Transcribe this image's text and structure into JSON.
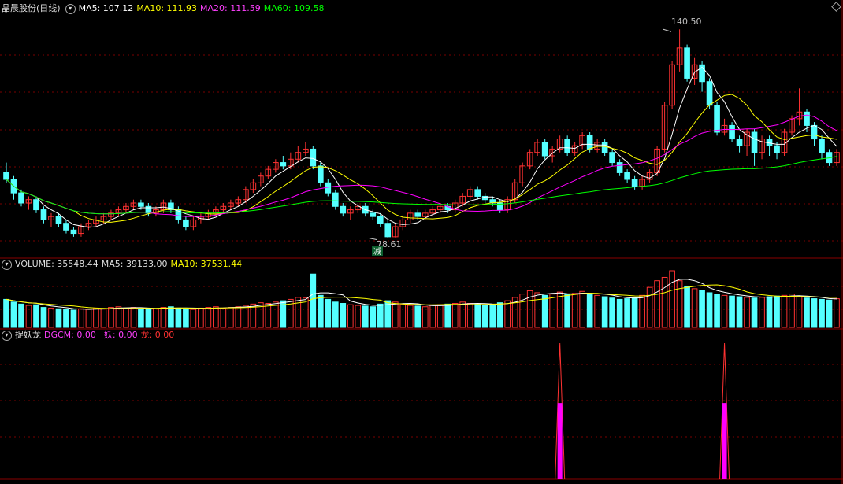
{
  "header": {
    "stock_name": "晶晨股份(日线)",
    "ma5": "MA5: 107.12",
    "ma10": "MA10: 111.93",
    "ma20": "MA20: 111.59",
    "ma60": "MA60: 109.58"
  },
  "volume_header": {
    "volume": "VOLUME: 35548.44",
    "ma5": "MA5: 39133.00",
    "ma10": "MA10: 37531.44"
  },
  "indicator_header": {
    "name": "捉妖龙",
    "dgcm": "DGCM: 0.00",
    "yao": "妖: 0.00",
    "long": "龙: 0.00"
  },
  "annotations": {
    "high_label": "140.50",
    "low_label": "78.61",
    "jian_marker": "减"
  },
  "colors": {
    "background": "#000000",
    "up": "#ff3232",
    "down": "#54ffff",
    "ma5": "#ffffff",
    "ma10": "#ffff00",
    "ma20": "#ff00ff",
    "ma60": "#00ff00",
    "grid": "#7a0000"
  },
  "chart_data": {
    "type": "candlestick",
    "price_high_marker": 140.5,
    "price_low_marker": 78.61,
    "candles": [
      {
        "o": 98,
        "c": 96,
        "h": 101,
        "l": 95
      },
      {
        "o": 96,
        "c": 92,
        "h": 97,
        "l": 90
      },
      {
        "o": 92,
        "c": 89,
        "h": 93,
        "l": 88
      },
      {
        "o": 89,
        "c": 90,
        "h": 91,
        "l": 87
      },
      {
        "o": 90,
        "c": 87,
        "h": 91,
        "l": 86
      },
      {
        "o": 87,
        "c": 84,
        "h": 88,
        "l": 83
      },
      {
        "o": 84,
        "c": 85,
        "h": 86,
        "l": 82
      },
      {
        "o": 85,
        "c": 83,
        "h": 86,
        "l": 82
      },
      {
        "o": 83,
        "c": 81,
        "h": 84,
        "l": 80
      },
      {
        "o": 81,
        "c": 80,
        "h": 82,
        "l": 79
      },
      {
        "o": 80,
        "c": 82,
        "h": 83,
        "l": 79
      },
      {
        "o": 82,
        "c": 83,
        "h": 84,
        "l": 81
      },
      {
        "o": 83,
        "c": 84,
        "h": 85,
        "l": 82
      },
      {
        "o": 84,
        "c": 85,
        "h": 86,
        "l": 83
      },
      {
        "o": 85,
        "c": 86,
        "h": 87,
        "l": 84
      },
      {
        "o": 86,
        "c": 87,
        "h": 88,
        "l": 85
      },
      {
        "o": 87,
        "c": 88,
        "h": 89,
        "l": 86
      },
      {
        "o": 88,
        "c": 89,
        "h": 90,
        "l": 87
      },
      {
        "o": 89,
        "c": 88,
        "h": 90,
        "l": 87
      },
      {
        "o": 88,
        "c": 86,
        "h": 89,
        "l": 85
      },
      {
        "o": 86,
        "c": 87,
        "h": 88,
        "l": 85
      },
      {
        "o": 87,
        "c": 89,
        "h": 90,
        "l": 86
      },
      {
        "o": 89,
        "c": 87,
        "h": 90,
        "l": 86
      },
      {
        "o": 87,
        "c": 84,
        "h": 88,
        "l": 83
      },
      {
        "o": 84,
        "c": 82,
        "h": 85,
        "l": 81
      },
      {
        "o": 82,
        "c": 84,
        "h": 85,
        "l": 81
      },
      {
        "o": 84,
        "c": 85,
        "h": 86,
        "l": 83
      },
      {
        "o": 85,
        "c": 86,
        "h": 87,
        "l": 84
      },
      {
        "o": 86,
        "c": 87,
        "h": 88,
        "l": 85
      },
      {
        "o": 87,
        "c": 88,
        "h": 89,
        "l": 86
      },
      {
        "o": 88,
        "c": 89,
        "h": 90,
        "l": 87
      },
      {
        "o": 89,
        "c": 90,
        "h": 91,
        "l": 88
      },
      {
        "o": 90,
        "c": 93,
        "h": 94,
        "l": 89
      },
      {
        "o": 93,
        "c": 95,
        "h": 96,
        "l": 92
      },
      {
        "o": 95,
        "c": 97,
        "h": 98,
        "l": 94
      },
      {
        "o": 97,
        "c": 99,
        "h": 100,
        "l": 96
      },
      {
        "o": 99,
        "c": 101,
        "h": 102,
        "l": 98
      },
      {
        "o": 101,
        "c": 100,
        "h": 103,
        "l": 99
      },
      {
        "o": 100,
        "c": 102,
        "h": 104,
        "l": 99
      },
      {
        "o": 102,
        "c": 104,
        "h": 106,
        "l": 101
      },
      {
        "o": 104,
        "c": 105,
        "h": 107,
        "l": 103
      },
      {
        "o": 105,
        "c": 100,
        "h": 106,
        "l": 99
      },
      {
        "o": 100,
        "c": 95,
        "h": 101,
        "l": 94
      },
      {
        "o": 95,
        "c": 92,
        "h": 96,
        "l": 91
      },
      {
        "o": 92,
        "c": 88,
        "h": 93,
        "l": 87
      },
      {
        "o": 88,
        "c": 86,
        "h": 89,
        "l": 85
      },
      {
        "o": 86,
        "c": 87,
        "h": 88,
        "l": 84
      },
      {
        "o": 87,
        "c": 88,
        "h": 89,
        "l": 86
      },
      {
        "o": 88,
        "c": 86,
        "h": 89,
        "l": 85
      },
      {
        "o": 86,
        "c": 85,
        "h": 87,
        "l": 84
      },
      {
        "o": 85,
        "c": 83,
        "h": 86,
        "l": 82
      },
      {
        "o": 83,
        "c": 79,
        "h": 84,
        "l": 78.61
      },
      {
        "o": 79,
        "c": 82,
        "h": 83,
        "l": 78.8
      },
      {
        "o": 82,
        "c": 84,
        "h": 85,
        "l": 81
      },
      {
        "o": 84,
        "c": 86,
        "h": 87,
        "l": 83
      },
      {
        "o": 86,
        "c": 85,
        "h": 87,
        "l": 84
      },
      {
        "o": 85,
        "c": 86,
        "h": 87,
        "l": 84
      },
      {
        "o": 86,
        "c": 87,
        "h": 88,
        "l": 85
      },
      {
        "o": 87,
        "c": 88,
        "h": 89,
        "l": 86
      },
      {
        "o": 88,
        "c": 87,
        "h": 89,
        "l": 86
      },
      {
        "o": 87,
        "c": 89,
        "h": 90,
        "l": 86
      },
      {
        "o": 89,
        "c": 91,
        "h": 92,
        "l": 88
      },
      {
        "o": 91,
        "c": 93,
        "h": 94,
        "l": 90
      },
      {
        "o": 93,
        "c": 91,
        "h": 94,
        "l": 90
      },
      {
        "o": 91,
        "c": 90,
        "h": 92,
        "l": 89
      },
      {
        "o": 90,
        "c": 89,
        "h": 91,
        "l": 88
      },
      {
        "o": 89,
        "c": 87,
        "h": 90,
        "l": 86
      },
      {
        "o": 87,
        "c": 90,
        "h": 91,
        "l": 86
      },
      {
        "o": 90,
        "c": 95,
        "h": 96,
        "l": 89
      },
      {
        "o": 95,
        "c": 100,
        "h": 101,
        "l": 94
      },
      {
        "o": 100,
        "c": 104,
        "h": 105,
        "l": 99
      },
      {
        "o": 104,
        "c": 107,
        "h": 108,
        "l": 103
      },
      {
        "o": 107,
        "c": 103,
        "h": 108,
        "l": 102
      },
      {
        "o": 103,
        "c": 105,
        "h": 106,
        "l": 101
      },
      {
        "o": 105,
        "c": 108,
        "h": 109,
        "l": 104
      },
      {
        "o": 108,
        "c": 104,
        "h": 109,
        "l": 103
      },
      {
        "o": 104,
        "c": 106,
        "h": 107,
        "l": 103
      },
      {
        "o": 106,
        "c": 109,
        "h": 110,
        "l": 105
      },
      {
        "o": 109,
        "c": 105,
        "h": 110,
        "l": 104
      },
      {
        "o": 105,
        "c": 107,
        "h": 108,
        "l": 104
      },
      {
        "o": 107,
        "c": 104,
        "h": 108,
        "l": 103
      },
      {
        "o": 104,
        "c": 101,
        "h": 105,
        "l": 100
      },
      {
        "o": 101,
        "c": 98,
        "h": 102,
        "l": 97
      },
      {
        "o": 98,
        "c": 96,
        "h": 99,
        "l": 95
      },
      {
        "o": 96,
        "c": 94,
        "h": 97,
        "l": 93
      },
      {
        "o": 94,
        "c": 96,
        "h": 97,
        "l": 93
      },
      {
        "o": 96,
        "c": 98,
        "h": 99,
        "l": 95
      },
      {
        "o": 98,
        "c": 105,
        "h": 106,
        "l": 97
      },
      {
        "o": 105,
        "c": 118,
        "h": 119,
        "l": 104
      },
      {
        "o": 118,
        "c": 130,
        "h": 131,
        "l": 117
      },
      {
        "o": 130,
        "c": 135,
        "h": 140.5,
        "l": 128
      },
      {
        "o": 135,
        "c": 126,
        "h": 136,
        "l": 125
      },
      {
        "o": 126,
        "c": 130,
        "h": 132,
        "l": 124
      },
      {
        "o": 130,
        "c": 125,
        "h": 131,
        "l": 122
      },
      {
        "o": 125,
        "c": 118,
        "h": 126,
        "l": 117
      },
      {
        "o": 118,
        "c": 110,
        "h": 119,
        "l": 109
      },
      {
        "o": 110,
        "c": 112,
        "h": 114,
        "l": 109
      },
      {
        "o": 112,
        "c": 108,
        "h": 113,
        "l": 107
      },
      {
        "o": 108,
        "c": 106,
        "h": 109,
        "l": 104
      },
      {
        "o": 106,
        "c": 110,
        "h": 111,
        "l": 103
      },
      {
        "o": 110,
        "c": 104,
        "h": 111,
        "l": 100
      },
      {
        "o": 104,
        "c": 108,
        "h": 109,
        "l": 102
      },
      {
        "o": 108,
        "c": 106,
        "h": 109,
        "l": 103
      },
      {
        "o": 106,
        "c": 104,
        "h": 107,
        "l": 102
      },
      {
        "o": 104,
        "c": 110,
        "h": 111,
        "l": 103
      },
      {
        "o": 110,
        "c": 114,
        "h": 115,
        "l": 109
      },
      {
        "o": 114,
        "c": 116,
        "h": 123,
        "l": 112
      },
      {
        "o": 116,
        "c": 112,
        "h": 117,
        "l": 110
      },
      {
        "o": 112,
        "c": 108,
        "h": 113,
        "l": 106
      },
      {
        "o": 108,
        "c": 104,
        "h": 109,
        "l": 102
      },
      {
        "o": 104,
        "c": 101,
        "h": 105,
        "l": 100
      },
      {
        "o": 101,
        "c": 104,
        "h": 105,
        "l": 100
      }
    ],
    "volume": [
      42,
      38,
      35,
      33,
      34,
      30,
      29,
      28,
      27,
      26,
      28,
      27,
      29,
      28,
      30,
      31,
      29,
      30,
      28,
      27,
      28,
      30,
      31,
      29,
      28,
      27,
      29,
      30,
      31,
      29,
      30,
      31,
      33,
      35,
      37,
      36,
      38,
      40,
      42,
      45,
      44,
      80,
      48,
      42,
      38,
      36,
      34,
      33,
      32,
      31,
      35,
      40,
      38,
      34,
      33,
      32,
      31,
      33,
      34,
      35,
      36,
      38,
      36,
      35,
      34,
      33,
      37,
      40,
      45,
      50,
      55,
      52,
      48,
      50,
      53,
      49,
      51,
      54,
      50,
      48,
      46,
      44,
      42,
      43,
      45,
      48,
      60,
      70,
      75,
      85,
      70,
      62,
      58,
      55,
      52,
      50,
      48,
      47,
      46,
      45,
      44,
      45,
      46,
      47,
      48,
      50,
      46,
      44,
      43,
      42,
      41,
      43
    ],
    "indicator_spikes": [
      {
        "index": 74,
        "value": 1.0,
        "fill": 0.56
      },
      {
        "index": 96,
        "value": 1.0,
        "fill": 0.56
      }
    ]
  }
}
